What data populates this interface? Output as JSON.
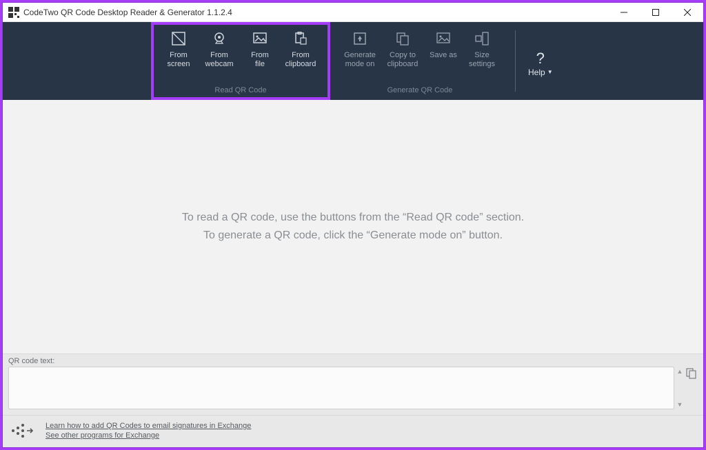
{
  "window": {
    "title": "CodeTwo QR Code Desktop Reader & Generator 1.1.2.4"
  },
  "ribbon": {
    "read": {
      "caption": "Read QR Code",
      "fromScreenL1": "From",
      "fromScreenL2": "screen",
      "fromWebcamL1": "From",
      "fromWebcamL2": "webcam",
      "fromFileL1": "From",
      "fromFileL2": "file",
      "fromClipboardL1": "From",
      "fromClipboardL2": "clipboard"
    },
    "generate": {
      "caption": "Generate QR Code",
      "modeOnL1": "Generate",
      "modeOnL2": "mode on",
      "copyClipL1": "Copy to",
      "copyClipL2": "clipboard",
      "saveAsL1": "Save as",
      "saveAsL2": "",
      "sizeSettingsL1": "Size",
      "sizeSettingsL2": "settings"
    },
    "help": "Help"
  },
  "content": {
    "line1": "To read a QR code, use the buttons from the “Read QR code” section.",
    "line2": "To generate a QR code, click the “Generate mode on” button."
  },
  "qrPanel": {
    "label": "QR code text:",
    "value": ""
  },
  "footer": {
    "link1": "Learn how to add QR Codes to email signatures in Exchange",
    "link2": "See other programs for Exchange"
  }
}
